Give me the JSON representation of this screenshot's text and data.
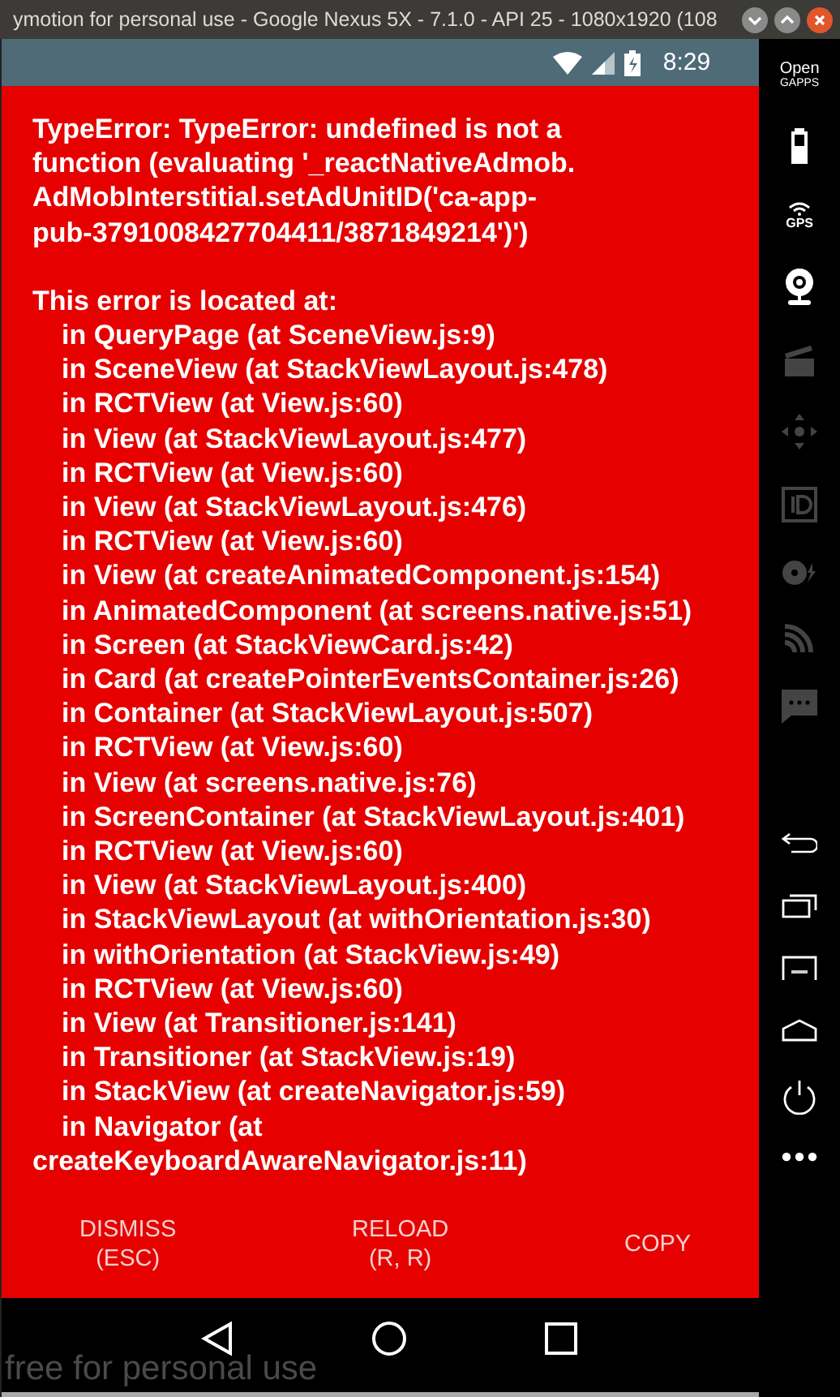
{
  "window": {
    "title": "ymotion for personal use - Google Nexus 5X - 7.1.0 - API 25 - 1080x1920 (108"
  },
  "status_bar": {
    "time": "8:29"
  },
  "error": {
    "message": "TypeError: TypeError: undefined is not a\nfunction (evaluating '_reactNativeAdmob.\nAdMobInterstitial.setAdUnitID('ca-app-\npub-3791008427704411/3871849214')')",
    "location_heading": "This error is located at:",
    "frames": [
      "in QueryPage (at SceneView.js:9)",
      "in SceneView (at StackViewLayout.js:478)",
      "in RCTView (at View.js:60)",
      "in View (at StackViewLayout.js:477)",
      "in RCTView (at View.js:60)",
      "in View (at StackViewLayout.js:476)",
      "in RCTView (at View.js:60)",
      "in View (at createAnimatedComponent.js:154)",
      "in AnimatedComponent (at screens.native.js:51)",
      "in Screen (at StackViewCard.js:42)",
      "in Card (at createPointerEventsContainer.js:26)",
      "in Container (at StackViewLayout.js:507)",
      "in RCTView (at View.js:60)",
      "in View (at screens.native.js:76)",
      "in ScreenContainer (at StackViewLayout.js:401)",
      "in RCTView (at View.js:60)",
      "in View (at StackViewLayout.js:400)",
      "in StackViewLayout (at withOrientation.js:30)",
      "in withOrientation (at StackView.js:49)",
      "in RCTView (at View.js:60)",
      "in View (at Transitioner.js:141)",
      "in Transitioner (at StackView.js:19)",
      "in StackView (at createNavigator.js:59)",
      "in Navigator (at createKeyboardAwareNavigator.js:11)"
    ]
  },
  "error_buttons": [
    {
      "label": "DISMISS",
      "shortcut": "(ESC)"
    },
    {
      "label": "RELOAD",
      "shortcut": "(R, R)"
    },
    {
      "label": "COPY"
    }
  ],
  "sidebar": {
    "gapps_label": [
      "Open",
      "GAPPS"
    ],
    "gps_label": "GPS"
  },
  "watermark_text": "free for personal use"
}
